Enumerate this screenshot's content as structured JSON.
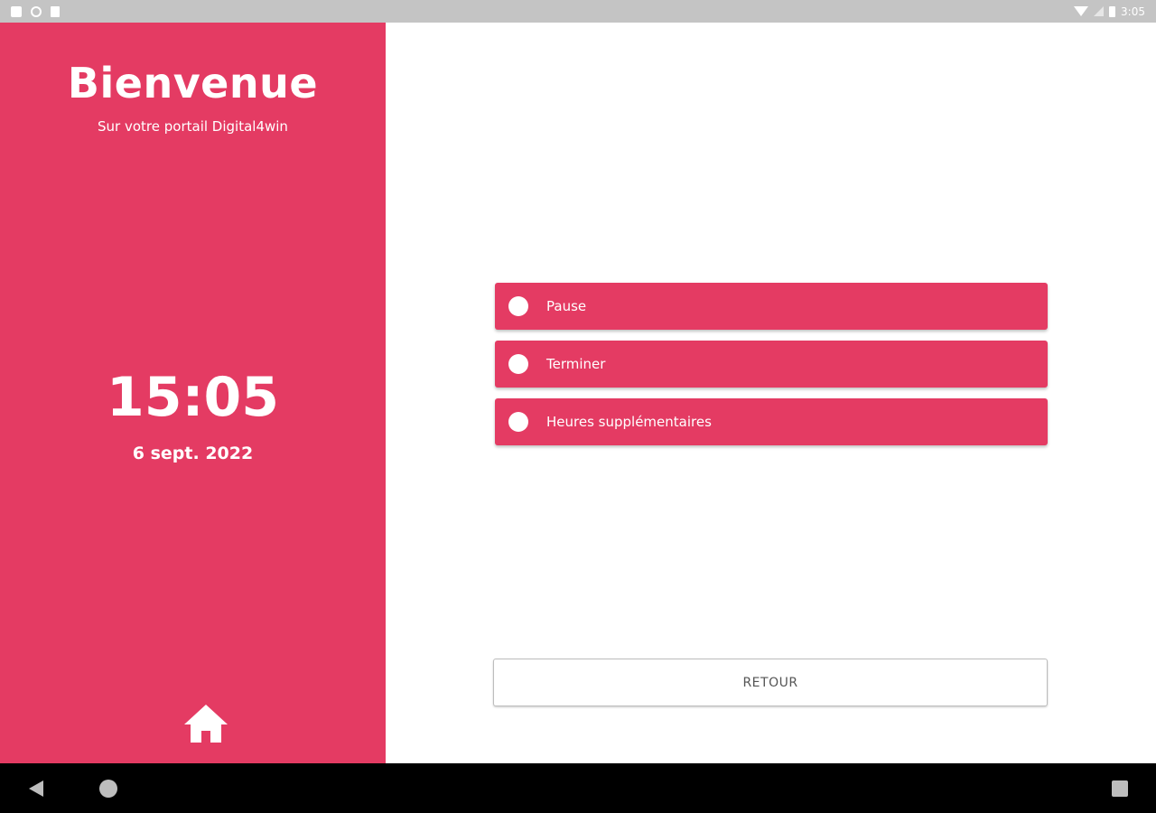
{
  "status_bar": {
    "time": "3:05"
  },
  "left_panel": {
    "title": "Bienvenue",
    "subtitle": "Sur votre portail Digital4win",
    "clock": "15:05",
    "date": "6 sept. 2022",
    "home_icon": "home-icon"
  },
  "options": [
    {
      "label": "Pause"
    },
    {
      "label": "Terminer"
    },
    {
      "label": "Heures supplémentaires"
    }
  ],
  "retour_button": {
    "label": "RETOUR"
  },
  "colors": {
    "accent": "#e43b63",
    "status_bar": "#c4c4c4",
    "nav_bar": "#000000"
  },
  "nav_bar": {
    "icons": [
      "back-icon",
      "home-circle-icon",
      "recent-apps-icon"
    ]
  }
}
